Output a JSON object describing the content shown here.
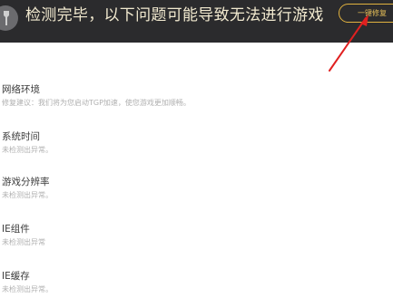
{
  "header": {
    "title": "检测完毕，以下问题可能导致无法进行游戏",
    "fix_button_label": "一键修复"
  },
  "issues": [
    {
      "title": "网络环境",
      "status": "修复建议：我们将为您启动TGP加速，使您游戏更加顺畅。"
    },
    {
      "title": "系统时间",
      "status": "未检测出异常。"
    },
    {
      "title": "游戏分辨率",
      "status": "未检测出异常。"
    },
    {
      "title": "IE组件",
      "status": "未检测出异常"
    },
    {
      "title": "IE缓存",
      "status": "未检测出异常。"
    }
  ],
  "colors": {
    "header_bg": "#2b2b2d",
    "title_text": "#f1e9cf",
    "button_accent": "#e1b23f",
    "annotation_arrow": "#e02020"
  }
}
